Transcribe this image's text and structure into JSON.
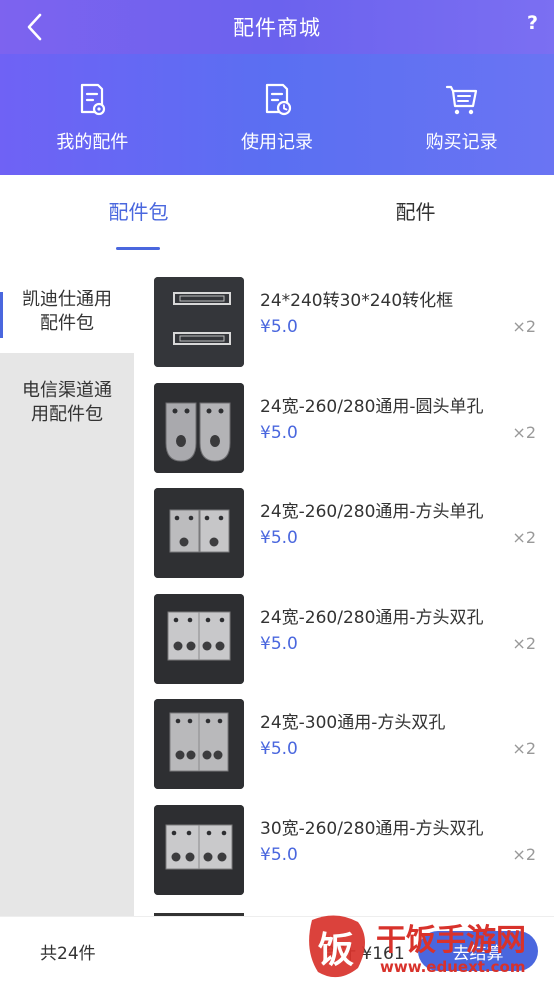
{
  "header": {
    "title": "配件商城",
    "help": "?",
    "quicknav": [
      {
        "label": "我的配件",
        "icon": "document-badge-icon"
      },
      {
        "label": "使用记录",
        "icon": "document-clock-icon"
      },
      {
        "label": "购买记录",
        "icon": "cart-list-icon"
      }
    ]
  },
  "tabs": [
    {
      "label": "配件包",
      "active": true
    },
    {
      "label": "配件",
      "active": false
    }
  ],
  "sidebar": {
    "categories": [
      {
        "label": "凯迪仕通用配件包",
        "active": true
      },
      {
        "label": "电信渠道通用配件包",
        "active": false
      }
    ]
  },
  "products": [
    {
      "name": "24*240转30*240转化框",
      "price": "¥5.0",
      "qty": "×2"
    },
    {
      "name": "24宽-260/280通用-圆头单孔",
      "price": "¥5.0",
      "qty": "×2"
    },
    {
      "name": "24宽-260/280通用-方头单孔",
      "price": "¥5.0",
      "qty": "×2"
    },
    {
      "name": "24宽-260/280通用-方头双孔",
      "price": "¥5.0",
      "qty": "×2"
    },
    {
      "name": "24宽-300通用-方头双孔",
      "price": "¥5.0",
      "qty": "×2"
    },
    {
      "name": "30宽-260/280通用-方头双孔",
      "price": "¥5.0",
      "qty": "×2"
    }
  ],
  "footer": {
    "count": "共24件",
    "amount": "合计 ¥161",
    "checkout": "去结算"
  },
  "watermark": {
    "logo_char": "饭",
    "brand": "干饭手游网",
    "url": "www.eduext.com"
  },
  "colors": {
    "accent": "#4a67de",
    "header_start": "#6f62f5",
    "header_end": "#6a74f3"
  }
}
